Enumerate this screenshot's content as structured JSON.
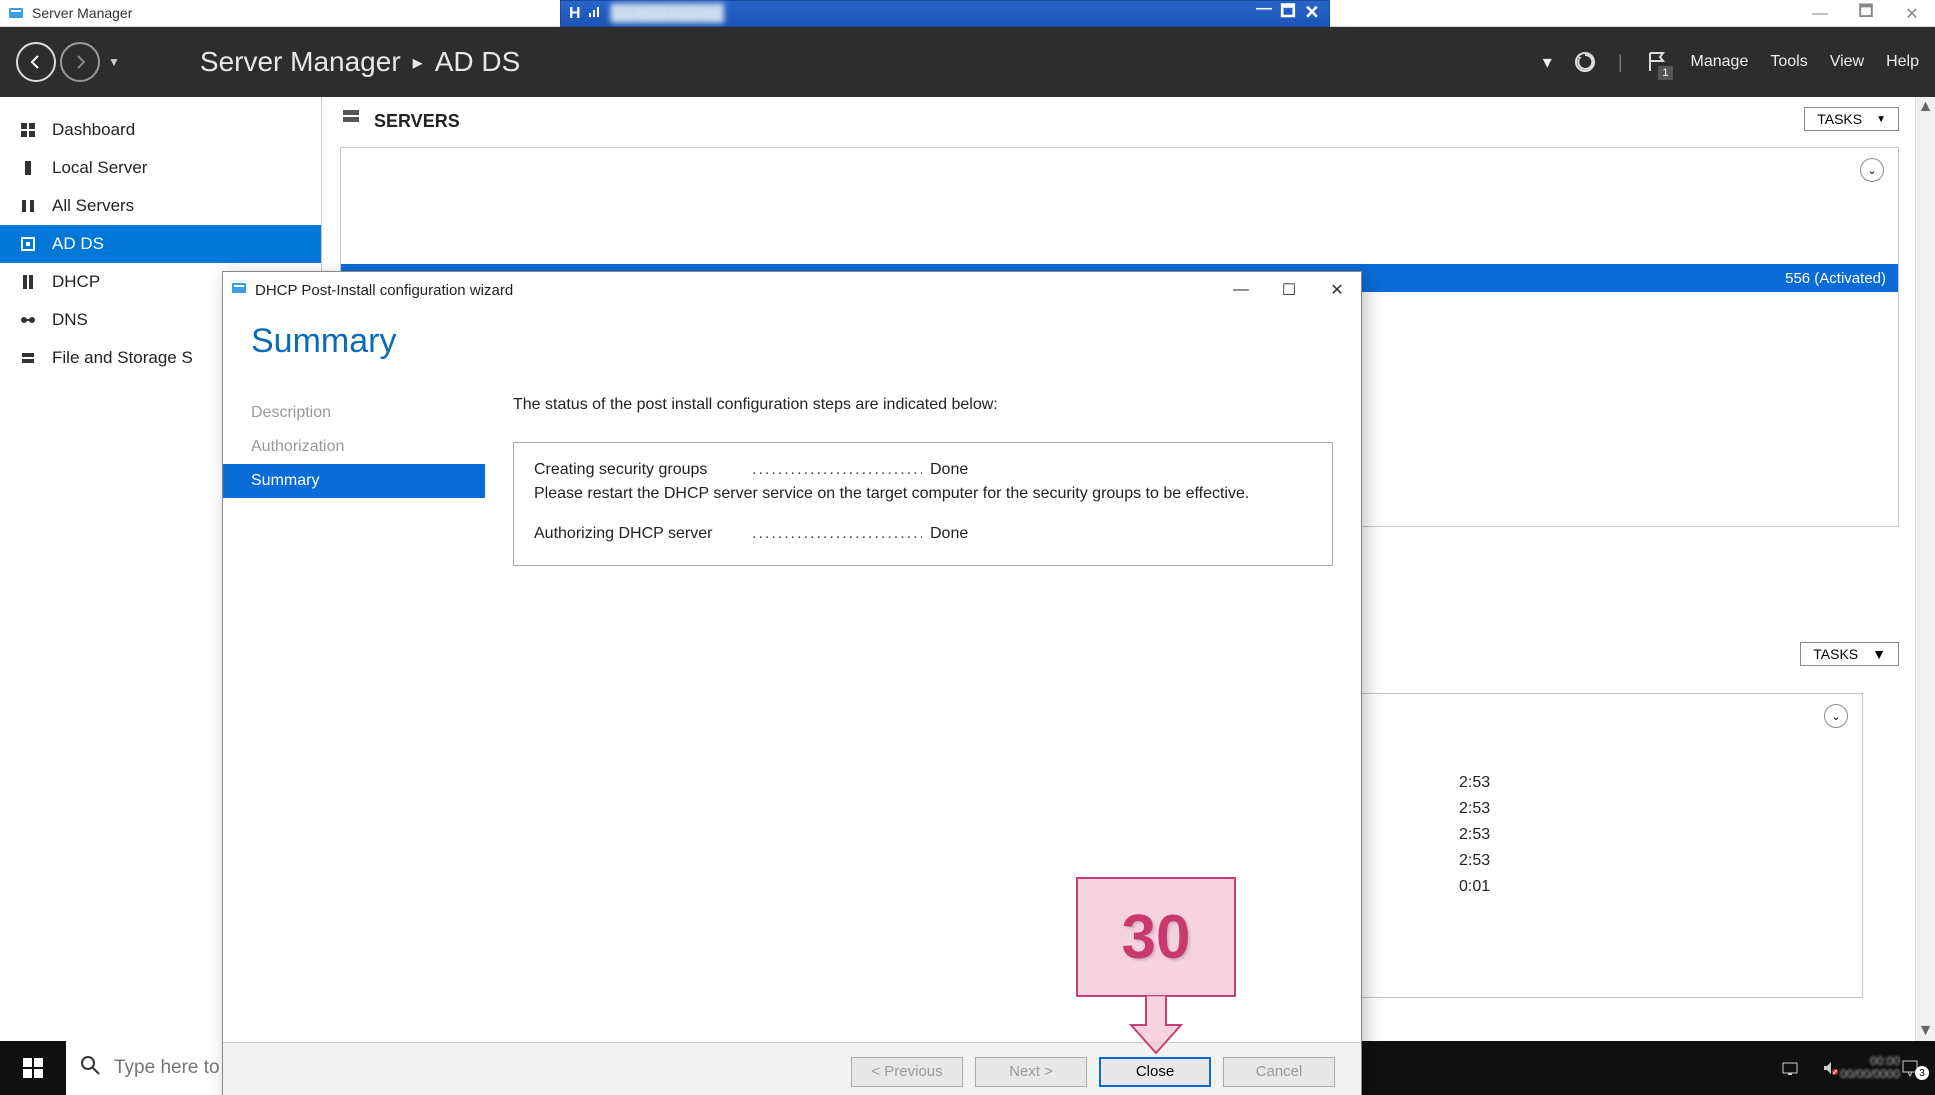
{
  "outer_window": {
    "title": "Server Manager",
    "inner_title_fragment": "H ..il",
    "minimize": "—",
    "max": "🗖",
    "close": "🗙"
  },
  "header": {
    "crumb1": "Server Manager",
    "crumb2": "AD DS",
    "sep": "▸",
    "flag_badge": "1",
    "menus": {
      "manage": "Manage",
      "tools": "Tools",
      "view": "View",
      "help": "Help"
    }
  },
  "sidebar": {
    "items": [
      {
        "label": "Dashboard"
      },
      {
        "label": "Local Server"
      },
      {
        "label": "All Servers"
      },
      {
        "label": "AD DS"
      },
      {
        "label": "DHCP"
      },
      {
        "label": "DNS"
      },
      {
        "label": "File and Storage S"
      }
    ]
  },
  "main": {
    "servers_heading": "SERVERS",
    "tasks_label": "TASKS",
    "panel1_row": "556 (Activated)",
    "panel2_times": [
      "2:53",
      "2:53",
      "2:53",
      "2:53",
      "0:01"
    ]
  },
  "dialog": {
    "title": "DHCP Post-Install configuration wizard",
    "heading": "Summary",
    "steps": {
      "description": "Description",
      "authorization": "Authorization",
      "summary": "Summary"
    },
    "intro": "The status of the post install configuration steps are indicated below:",
    "row1": {
      "label": "Creating security groups",
      "status": "Done"
    },
    "note": "Please restart the DHCP server service on the target computer for the security groups to be effective.",
    "row2": {
      "label": "Authorizing DHCP server",
      "status": "Done"
    },
    "buttons": {
      "previous": "< Previous",
      "next": "Next >",
      "close": "Close",
      "cancel": "Cancel"
    },
    "winctl": {
      "min": "—",
      "max": "☐",
      "close": "✕"
    }
  },
  "callout": {
    "number": "30"
  },
  "taskbar": {
    "search_placeholder": "Type here to search",
    "notif_count": "3"
  }
}
